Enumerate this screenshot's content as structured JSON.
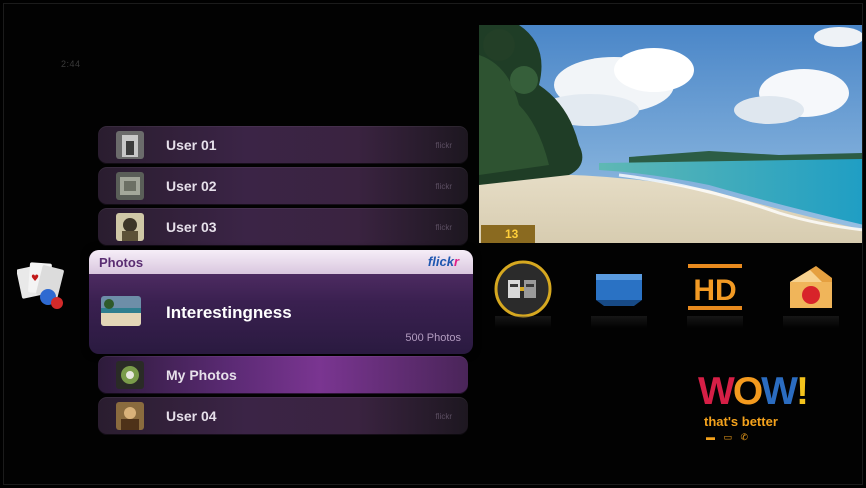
{
  "clock": "2:44",
  "list": {
    "items_top": [
      {
        "label": "User 01",
        "source": "flickr"
      },
      {
        "label": "User 02",
        "source": "flickr"
      },
      {
        "label": "User 03",
        "source": "flickr"
      }
    ],
    "expanded": {
      "header_title": "Photos",
      "brand_part1": "flick",
      "brand_part2": "r",
      "main_label": "Interestingness",
      "count": "500 Photos"
    },
    "items_bottom": [
      {
        "label": "My Photos",
        "source": ""
      },
      {
        "label": "User 04",
        "source": "flickr"
      }
    ]
  },
  "preview": {
    "badge": "13"
  },
  "tiles": {
    "hd_label": "HD"
  },
  "logo": {
    "word_w1": "W",
    "word_o": "O",
    "word_w2": "W",
    "word_bang": "!",
    "tagline": "that's better",
    "devices": "▬ ▭ ✆"
  },
  "colors": {
    "accent_purple": "#7a3591",
    "badge_gold": "#ffcf3a",
    "wow_orange": "#f4a21c"
  }
}
